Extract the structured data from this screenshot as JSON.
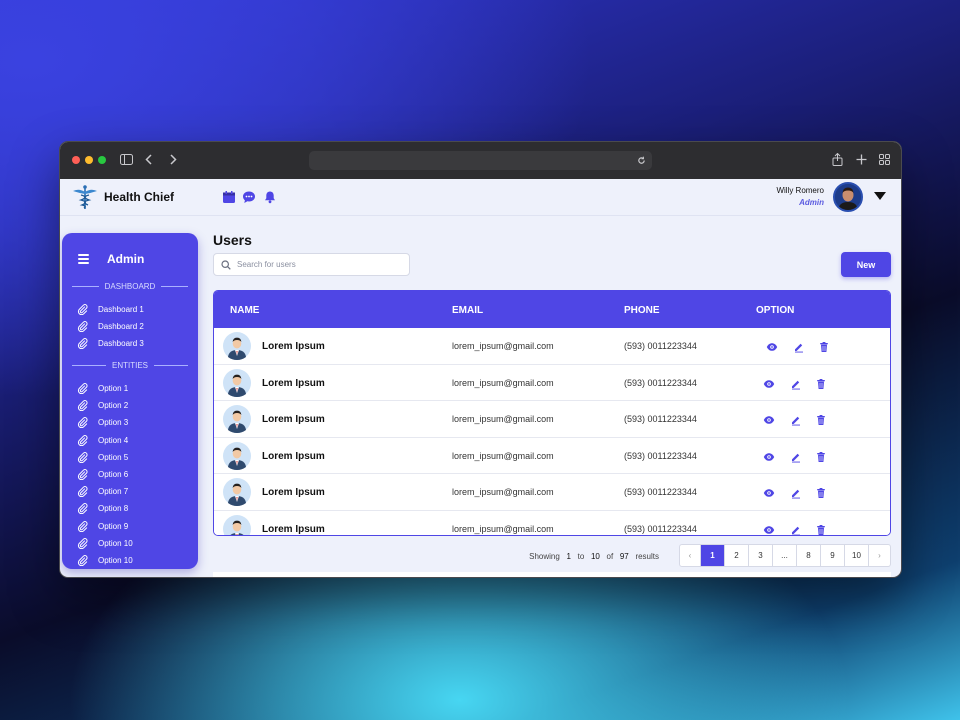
{
  "app": {
    "brand": "Health Chief"
  },
  "user": {
    "name": "Willy Romero",
    "role": "Admin"
  },
  "sidebar": {
    "title": "Admin",
    "section_dashboard": "DASHBOARD",
    "dashboards": [
      {
        "label": "Dashboard 1"
      },
      {
        "label": "Dashboard 2"
      },
      {
        "label": "Dashboard 3"
      }
    ],
    "section_entities": "ENTITIES",
    "options": [
      {
        "label": "Option 1"
      },
      {
        "label": "Option 2"
      },
      {
        "label": "Option 3"
      },
      {
        "label": "Option 4"
      },
      {
        "label": "Option 5"
      },
      {
        "label": "Option 6"
      },
      {
        "label": "Option 7"
      },
      {
        "label": "Option 8"
      },
      {
        "label": "Option 9"
      },
      {
        "label": "Option 10"
      },
      {
        "label": "Option 10"
      }
    ]
  },
  "main": {
    "title": "Users",
    "search_placeholder": "Search for users",
    "new_label": "New"
  },
  "table": {
    "columns": [
      "NAME",
      "EMAIL",
      "PHONE",
      "OPTION"
    ],
    "rows": [
      {
        "name": "Lorem Ipsum",
        "email": "lorem_ipsum@gmail.com",
        "phone": "(593) 0011223344"
      },
      {
        "name": "Lorem Ipsum",
        "email": "lorem_ipsum@gmail.com",
        "phone": "(593) 0011223344"
      },
      {
        "name": "Lorem Ipsum",
        "email": "lorem_ipsum@gmail.com",
        "phone": "(593) 0011223344"
      },
      {
        "name": "Lorem Ipsum",
        "email": "lorem_ipsum@gmail.com",
        "phone": "(593) 0011223344"
      },
      {
        "name": "Lorem Ipsum",
        "email": "lorem_ipsum@gmail.com",
        "phone": "(593) 0011223344"
      },
      {
        "name": "Lorem Ipsum",
        "email": "lorem_ipsum@gmail.com",
        "phone": "(593) 0011223344"
      }
    ]
  },
  "pagination": {
    "showing": "Showing",
    "from": "1",
    "to_word": "to",
    "to": "10",
    "of_word": "of",
    "total": "97",
    "results_word": "results",
    "pages": [
      "1",
      "2",
      "3",
      "...",
      "8",
      "9",
      "10"
    ],
    "current": "1"
  },
  "colors": {
    "accent": "#4f46e5",
    "accent_light": "#eef1fb"
  },
  "icons": {
    "header": [
      "calendar-icon",
      "chat-icon",
      "bell-icon"
    ],
    "row_actions": [
      "eye-icon",
      "edit-icon",
      "trash-icon"
    ],
    "sidebar_item": "paperclip-icon"
  }
}
